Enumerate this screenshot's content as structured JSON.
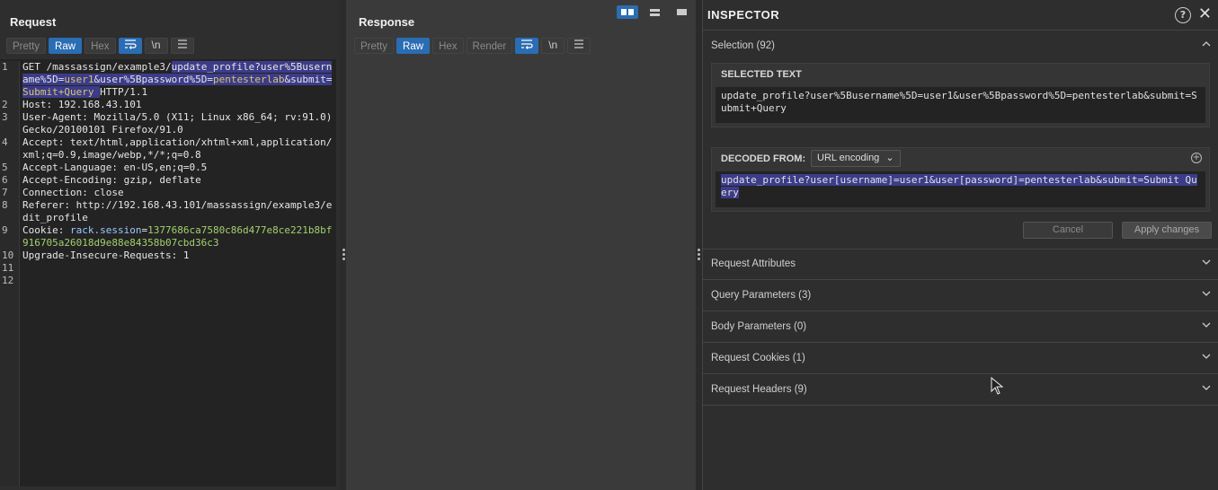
{
  "request": {
    "title": "Request",
    "tabs": [
      "Pretty",
      "Raw",
      "Hex"
    ],
    "active_tab": "Raw",
    "lines": [
      {
        "n": "1",
        "segments": [
          {
            "t": "GET /massassign/example3/",
            "c": "code"
          },
          {
            "t": "update_profile?",
            "c": "hl"
          },
          {
            "t": "user%5Busername%5D",
            "c": "hl"
          },
          {
            "t": "=",
            "c": "hl"
          },
          {
            "t": "user1",
            "c": "hl param"
          },
          {
            "t": "&",
            "c": "hl"
          },
          {
            "t": "user%5Bpassword%5D",
            "c": "hl"
          },
          {
            "t": "=",
            "c": "hl"
          },
          {
            "t": "pentesterlab",
            "c": "hl param"
          },
          {
            "t": "&",
            "c": "hl"
          },
          {
            "t": "submit",
            "c": "hl"
          },
          {
            "t": "=",
            "c": "hl"
          },
          {
            "t": "Submit+Query",
            "c": "hl param"
          },
          {
            "t": " ",
            "c": "hl"
          },
          {
            "t": "HTTP/1.1",
            "c": "code"
          }
        ]
      },
      {
        "n": "2",
        "segments": [
          {
            "t": "Host: ",
            "c": "hdr-name"
          },
          {
            "t": "192.168.43.101",
            "c": "hdr-val"
          }
        ]
      },
      {
        "n": "3",
        "segments": [
          {
            "t": "User-Agent: ",
            "c": "hdr-name"
          },
          {
            "t": "Mozilla/5.0 (X11; Linux x86_64; rv:91.0) Gecko/20100101 Firefox/91.0",
            "c": "hdr-val"
          }
        ]
      },
      {
        "n": "4",
        "segments": [
          {
            "t": "Accept: ",
            "c": "hdr-name"
          },
          {
            "t": "text/html,application/xhtml+xml,application/xml;q=0.9,image/webp,*/*;q=0.8",
            "c": "hdr-val"
          }
        ]
      },
      {
        "n": "5",
        "segments": [
          {
            "t": "Accept-Language: ",
            "c": "hdr-name"
          },
          {
            "t": "en-US,en;q=0.5",
            "c": "hdr-val"
          }
        ]
      },
      {
        "n": "6",
        "segments": [
          {
            "t": "Accept-Encoding: ",
            "c": "hdr-name"
          },
          {
            "t": "gzip, deflate",
            "c": "hdr-val"
          }
        ]
      },
      {
        "n": "7",
        "segments": [
          {
            "t": "Connection: ",
            "c": "hdr-name"
          },
          {
            "t": "close",
            "c": "hdr-val"
          }
        ]
      },
      {
        "n": "8",
        "segments": [
          {
            "t": "Referer: ",
            "c": "hdr-name"
          },
          {
            "t": "http://192.168.43.101/massassign/example3/edit_profile",
            "c": "hdr-val"
          }
        ]
      },
      {
        "n": "9",
        "segments": [
          {
            "t": "Cookie: ",
            "c": "hdr-name"
          },
          {
            "t": "rack.session",
            "c": "cookie-name"
          },
          {
            "t": "=",
            "c": "hdr-val"
          },
          {
            "t": "1377686ca7580c86d477e8ce221b8bf916705a26018d9e88e84358b07cbd36c3",
            "c": "cookie-val"
          }
        ]
      },
      {
        "n": "10",
        "segments": [
          {
            "t": "Upgrade-Insecure-Requests: ",
            "c": "hdr-name"
          },
          {
            "t": "1",
            "c": "hdr-val"
          }
        ]
      },
      {
        "n": "11",
        "segments": []
      },
      {
        "n": "12",
        "segments": []
      }
    ]
  },
  "response": {
    "title": "Response",
    "tabs": [
      "Pretty",
      "Raw",
      "Hex",
      "Render"
    ],
    "active_tab": "Raw"
  },
  "inspector": {
    "title": "INSPECTOR",
    "selection_label": "Selection (92)",
    "selected_text_title": "SELECTED TEXT",
    "selected_text": "update_profile?user%5Busername%5D=user1&user%5Bpassword%5D=pentesterlab&submit=Submit+Query",
    "decoded_from_title": "DECODED FROM:",
    "decoding": "URL encoding",
    "decoded_text": "update_profile?user[username]=user1&user[password]=pentesterlab&submit=Submit Query",
    "cancel_label": "Cancel",
    "apply_label": "Apply changes",
    "sections": [
      "Request Attributes",
      "Query Parameters (3)",
      "Body Parameters (0)",
      "Request Cookies (1)",
      "Request Headers (9)"
    ]
  },
  "colors": {
    "accent": "#2a6db3",
    "highlight": "#3c3c8a"
  }
}
